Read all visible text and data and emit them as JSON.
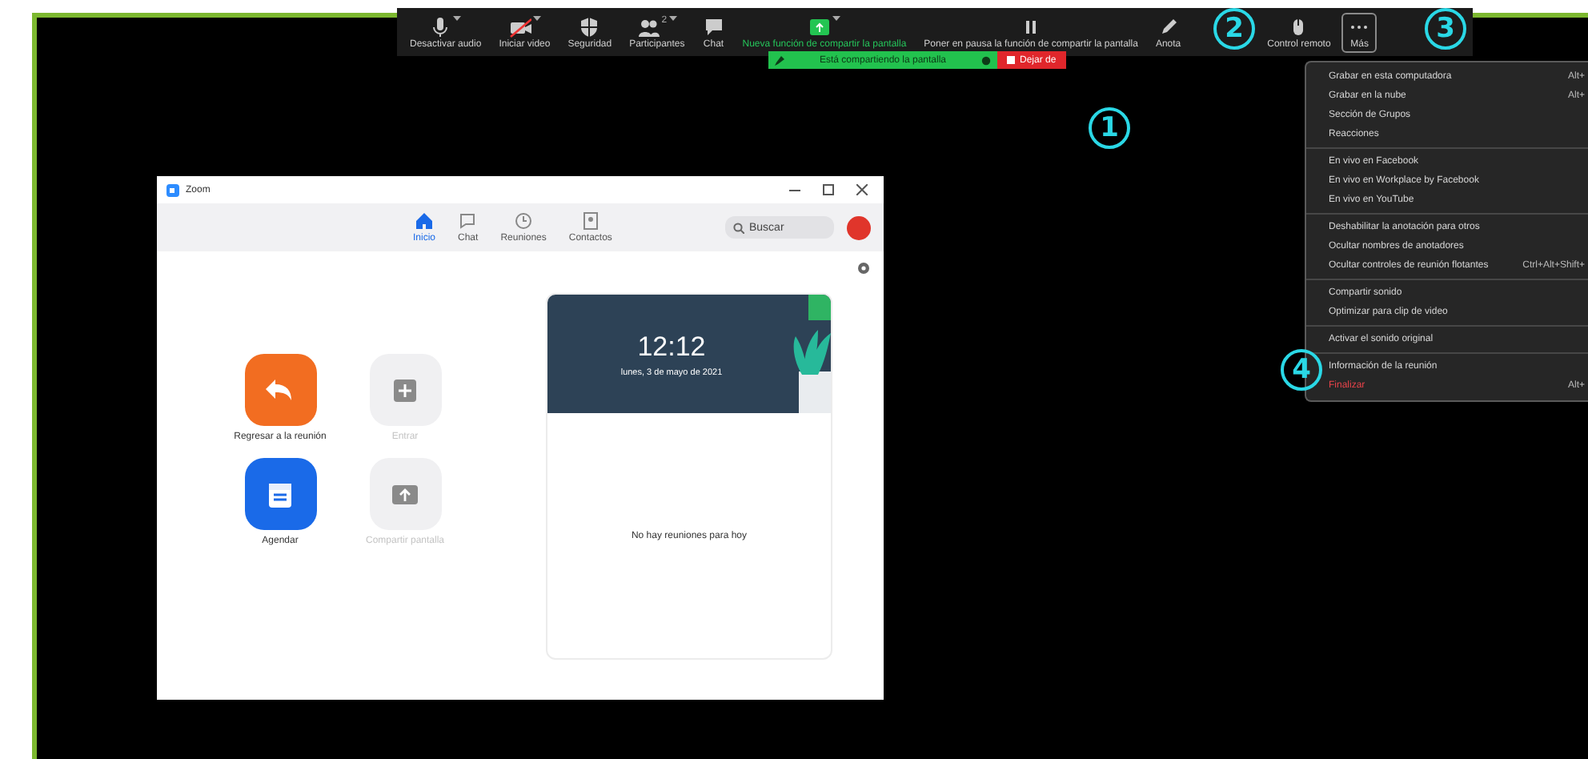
{
  "toolbar": {
    "items": [
      {
        "label": "Desactivar audio",
        "caret": true,
        "selected": false
      },
      {
        "label": "Iniciar video",
        "caret": true,
        "selected": false
      },
      {
        "label": "Seguridad",
        "caret": false,
        "selected": false
      },
      {
        "label": "Participantes",
        "caret": true,
        "count": "2",
        "selected": false
      },
      {
        "label": "Chat",
        "caret": false,
        "selected": false
      },
      {
        "label": "Nueva función de compartir la pantalla",
        "caret": true,
        "selected": false
      },
      {
        "label": "Poner en pausa la función de compartir la pantalla",
        "caret": false,
        "selected": false
      },
      {
        "label": "Anota",
        "caret": false,
        "selected": false
      },
      {
        "label": "Control remoto",
        "caret": false,
        "selected": false
      },
      {
        "label": "Más",
        "caret": false,
        "selected": true
      }
    ]
  },
  "share_bar": {
    "status": "Está compartiendo la pantalla",
    "stop_button": "Dejar de"
  },
  "more_menu": {
    "sections": [
      [
        {
          "label": "Grabar en esta computadora",
          "shortcut": "Alt+",
          "kind": "normal"
        },
        {
          "label": "Grabar en la nube",
          "shortcut": "Alt+",
          "kind": "normal"
        },
        {
          "label": "Sección de Grupos",
          "kind": "normal"
        },
        {
          "label": "Reacciones",
          "kind": "normal"
        }
      ],
      [
        {
          "label": "En vivo en Facebook",
          "kind": "normal"
        },
        {
          "label": "En vivo en Workplace by Facebook",
          "kind": "normal"
        },
        {
          "label": "En vivo en YouTube",
          "kind": "normal"
        }
      ],
      [
        {
          "label": "Deshabilitar la anotación para otros",
          "kind": "normal"
        },
        {
          "label": "Ocultar nombres de anotadores",
          "kind": "normal"
        },
        {
          "label": "Ocultar controles de reunión flotantes",
          "shortcut": "Ctrl+Alt+Shift+",
          "kind": "normal"
        }
      ],
      [
        {
          "label": "Compartir sonido",
          "kind": "normal"
        },
        {
          "label": "Optimizar para clip de video",
          "kind": "normal"
        }
      ],
      [
        {
          "label": "Activar el sonido original",
          "kind": "normal"
        }
      ],
      [
        {
          "label": "Información de la reunión",
          "kind": "normal"
        },
        {
          "label": "Finalizar",
          "shortcut": "Alt+",
          "kind": "danger"
        }
      ]
    ]
  },
  "zoom_window": {
    "title": "Zoom",
    "tabs": [
      {
        "label": "Inicio",
        "selected": true
      },
      {
        "label": "Chat",
        "selected": false
      },
      {
        "label": "Reuniones",
        "selected": false
      },
      {
        "label": "Contactos",
        "selected": false
      }
    ],
    "search": {
      "placeholder": "Buscar"
    },
    "actions": [
      {
        "label": "Regresar a la reunión",
        "disabled": false
      },
      {
        "label": "Entrar",
        "disabled": true
      },
      {
        "label": "Agendar",
        "disabled": false
      },
      {
        "label": "Compartir pantalla",
        "disabled": true
      }
    ],
    "calendar_card": {
      "time": "12:12",
      "date": "lunes, 3 de mayo de 2021",
      "empty_message": "No hay reuniones para hoy"
    }
  },
  "callouts": [
    {
      "number": "1"
    },
    {
      "number": "2"
    },
    {
      "number": "3"
    },
    {
      "number": "4"
    }
  ]
}
